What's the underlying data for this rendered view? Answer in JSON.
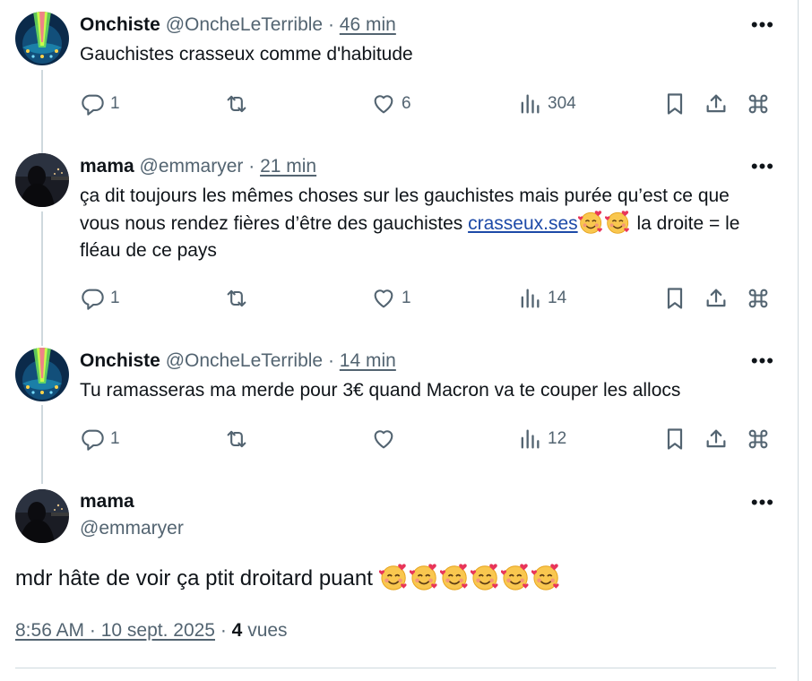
{
  "tweets": [
    {
      "name": "Onchiste",
      "handle": "@OncheLeTerrible",
      "separator": "·",
      "time": "46 min",
      "text": "Gauchistes crasseux comme d'habitude",
      "replies": "1",
      "retweets": "",
      "likes": "6",
      "views": "304",
      "avatar": "onchiste-avatar"
    },
    {
      "name": "mama",
      "handle": "@emmaryer",
      "separator": "·",
      "time": "21 min",
      "text_part1": "ça dit toujours les mêmes choses sur les gauchistes mais purée qu’est ce que vous nous rendez fières d’être des gauchistes ",
      "link": "crasseux.ses",
      "text_part2": " la droite = le fléau de ce pays",
      "replies": "1",
      "retweets": "",
      "likes": "1",
      "views": "14",
      "avatar": "mama-avatar"
    },
    {
      "name": "Onchiste",
      "handle": "@OncheLeTerrible",
      "separator": "·",
      "time": "14 min",
      "text": "Tu ramasseras ma merde pour 3€ quand Macron va te couper les allocs",
      "replies": "1",
      "retweets": "",
      "likes": "",
      "views": "12",
      "avatar": "onchiste-avatar"
    }
  ],
  "main_tweet": {
    "name": "mama",
    "handle": "@emmaryer",
    "text": "mdr hâte de voir ça ptit droitard puant",
    "emoji_count": 6,
    "timestamp": "8:56 AM · 10 sept. 2025",
    "meta_separator": "·",
    "views_count": "4",
    "views_label": "vues"
  },
  "icons": {
    "more": "more-horizontal-icon",
    "reply": "reply-icon",
    "retweet": "retweet-icon",
    "like": "heart-icon",
    "views": "views-chart-icon",
    "bookmark": "bookmark-icon",
    "share": "share-icon",
    "command": "command-key-icon",
    "emoji": "smiling-face-with-hearts-emoji"
  },
  "colors": {
    "text": "#0f1419",
    "secondary": "#536471",
    "link": "#1d4aa8",
    "border": "#cfd9de"
  },
  "more_label": "•••"
}
